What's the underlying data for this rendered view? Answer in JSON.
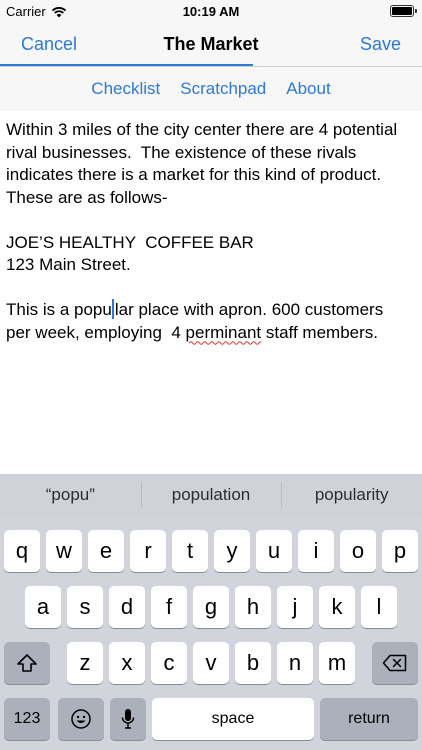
{
  "status": {
    "carrier": "Carrier",
    "time": "10:19 AM"
  },
  "nav": {
    "cancel": "Cancel",
    "title": "The Market",
    "save": "Save"
  },
  "tabs": [
    {
      "label": "Checklist"
    },
    {
      "label": "Scratchpad"
    },
    {
      "label": "About"
    }
  ],
  "editor": {
    "lines": [
      "Within 3 miles of the city center there are 4 potential",
      "rival businesses.  The existence of these rivals",
      "indicates there is a market for this kind of product.",
      "These are as follows-",
      "",
      "JOE’S HEALTHY  COFFEE BAR",
      "123 Main Street.",
      ""
    ],
    "p3a_before_cursor": "This is a popu",
    "p3a_after_cursor": "lar place with apron. 600 customers",
    "p3b_before": "per week, employing  4 ",
    "p3b_misspelled": "perminant",
    "p3b_after": " staff members."
  },
  "keyboard": {
    "suggestions": [
      "“popu”",
      "population",
      "popularity"
    ],
    "row1": [
      "q",
      "w",
      "e",
      "r",
      "t",
      "y",
      "u",
      "i",
      "o",
      "p"
    ],
    "row2": [
      "a",
      "s",
      "d",
      "f",
      "g",
      "h",
      "j",
      "k",
      "l"
    ],
    "row3": [
      "z",
      "x",
      "c",
      "v",
      "b",
      "n",
      "m"
    ],
    "numbers_key": "123",
    "space_key": "space",
    "return_key": "return",
    "icons": {
      "shift": "shift-icon",
      "delete": "delete-icon",
      "emoji": "emoji-icon",
      "mic": "microphone-icon"
    }
  },
  "colors": {
    "accent": "#2a7ad6",
    "keyboard_bg": "#d1d4da",
    "dark_key": "#abb0ba",
    "bar_bg": "#f7f7f7",
    "spell_error": "#e0322a"
  }
}
